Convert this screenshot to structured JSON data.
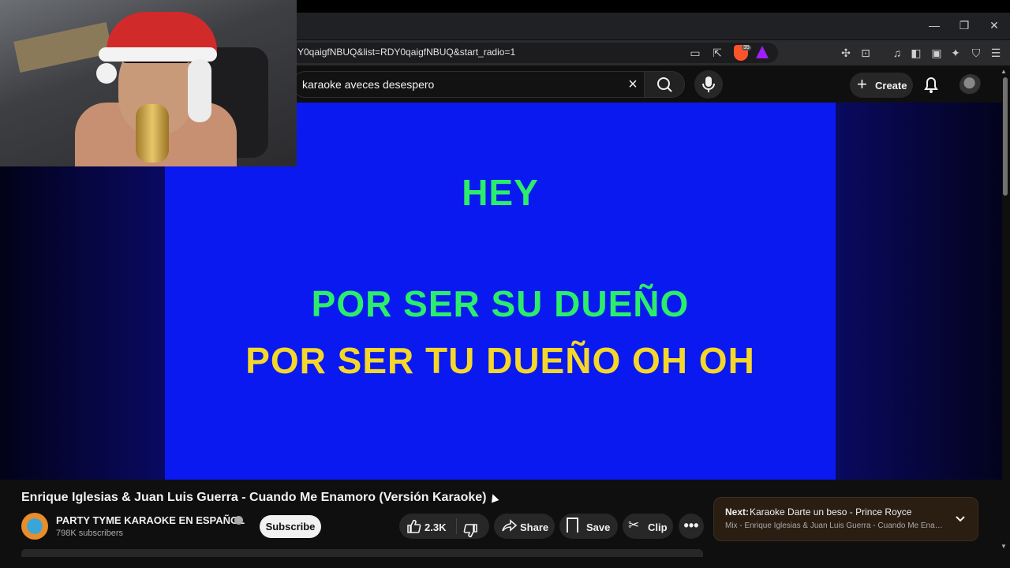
{
  "browser": {
    "url": "Y0qaigfNBUQ&list=RDY0qaigfNBUQ&start_radio=1",
    "window_controls": {
      "minimize": "—",
      "restore": "❐",
      "close": "✕"
    },
    "brave_badge": "35"
  },
  "masthead": {
    "search_query": "karaoke aveces desespero",
    "create_label": "Create"
  },
  "player": {
    "lyrics": [
      {
        "text": "HEY",
        "color": "#2bed6a"
      },
      {
        "text": "POR SER SU DUEÑO",
        "color": "#2bed6a"
      },
      {
        "text": "POR SER TU DUEÑO OH OH",
        "color": "#f5d72a"
      }
    ],
    "frame_color": "#0a19f0"
  },
  "video": {
    "title": "Enrique Iglesias & Juan Luis Guerra - Cuando Me Enamoro (Versión Karaoke)",
    "channel_name": "PARTY TYME KARAOKE EN ESPAÑOL",
    "subscribers": "798K subscribers",
    "subscribe_label": "Subscribe",
    "like_count": "2.3K",
    "share_label": "Share",
    "save_label": "Save",
    "clip_label": "Clip",
    "more_label": "•••"
  },
  "up_next": {
    "prefix": "Next:",
    "title": "Karaoke Darte un beso - Prince Royce",
    "subtitle": "Mix - Enrique Iglesias & Juan Luis Guerra - Cuando Me Enamoro (Versión Karaoke)"
  }
}
